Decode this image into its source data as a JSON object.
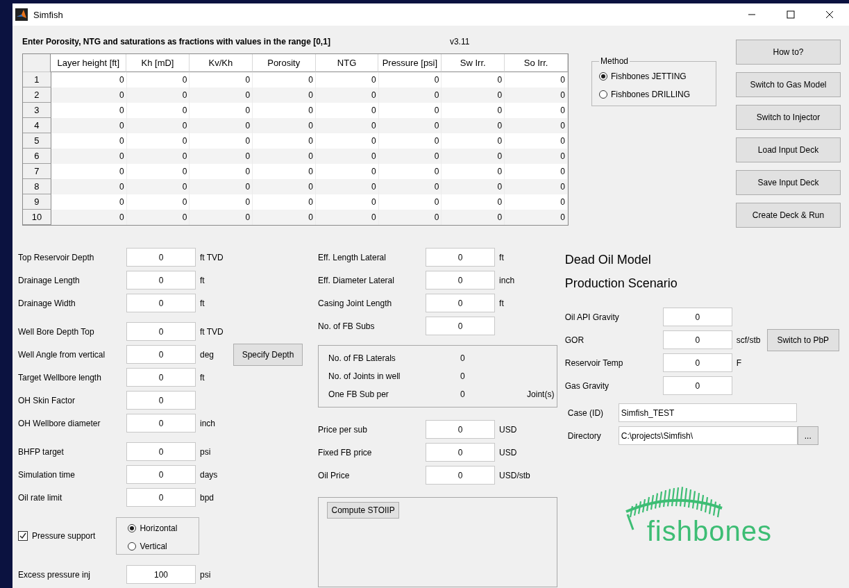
{
  "window": {
    "title": "Simfish"
  },
  "instructions": "Enter Porosity, NTG and saturations as fractions with values in the range [0,1]",
  "version": "v3.11",
  "table": {
    "columns": [
      "Layer height [ft]",
      "Kh [mD]",
      "Kv/Kh",
      "Porosity",
      "NTG",
      "Pressure [psi]",
      "Sw Irr.",
      "So Irr."
    ],
    "rows": [
      {
        "index": "1",
        "cells": [
          "0",
          "0",
          "0",
          "0",
          "0",
          "0",
          "0",
          "0"
        ]
      },
      {
        "index": "2",
        "cells": [
          "0",
          "0",
          "0",
          "0",
          "0",
          "0",
          "0",
          "0"
        ]
      },
      {
        "index": "3",
        "cells": [
          "0",
          "0",
          "0",
          "0",
          "0",
          "0",
          "0",
          "0"
        ]
      },
      {
        "index": "4",
        "cells": [
          "0",
          "0",
          "0",
          "0",
          "0",
          "0",
          "0",
          "0"
        ]
      },
      {
        "index": "5",
        "cells": [
          "0",
          "0",
          "0",
          "0",
          "0",
          "0",
          "0",
          "0"
        ]
      },
      {
        "index": "6",
        "cells": [
          "0",
          "0",
          "0",
          "0",
          "0",
          "0",
          "0",
          "0"
        ]
      },
      {
        "index": "7",
        "cells": [
          "0",
          "0",
          "0",
          "0",
          "0",
          "0",
          "0",
          "0"
        ]
      },
      {
        "index": "8",
        "cells": [
          "0",
          "0",
          "0",
          "0",
          "0",
          "0",
          "0",
          "0"
        ]
      },
      {
        "index": "9",
        "cells": [
          "0",
          "0",
          "0",
          "0",
          "0",
          "0",
          "0",
          "0"
        ]
      },
      {
        "index": "10",
        "cells": [
          "0",
          "0",
          "0",
          "0",
          "0",
          "0",
          "0",
          "0"
        ]
      }
    ]
  },
  "method": {
    "title": "Method",
    "options": [
      {
        "label": "Fishbones JETTING",
        "selected": true
      },
      {
        "label": "Fishbones DRILLING",
        "selected": false
      }
    ]
  },
  "buttons": [
    "How to?",
    "Switch to Gas Model",
    "Switch to Injector",
    "Load Input Deck",
    "Save Input Deck",
    "Create Deck & Run"
  ],
  "reservoir_groups": [
    [
      {
        "label": "Top Reservoir Depth",
        "value": "0",
        "unit": "ft TVD"
      },
      {
        "label": "Drainage Length",
        "value": "0",
        "unit": "ft"
      },
      {
        "label": "Drainage Width",
        "value": "0",
        "unit": "ft"
      }
    ],
    [
      {
        "label": "Well Bore Depth Top",
        "value": "0",
        "unit": "ft TVD"
      },
      {
        "label": "Well Angle from vertical",
        "value": "0",
        "unit": "deg",
        "button": "Specify Depth"
      },
      {
        "label": "Target Wellbore length",
        "value": "0",
        "unit": "ft"
      },
      {
        "label": "OH Skin Factor",
        "value": "0"
      },
      {
        "label": "OH Wellbore diameter",
        "value": "0",
        "unit": "inch"
      }
    ],
    [
      {
        "label": "BHFP target",
        "value": "0",
        "unit": "psi"
      },
      {
        "label": "Simulation time",
        "value": "0",
        "unit": "days"
      },
      {
        "label": "Oil rate limit",
        "value": "0",
        "unit": "bpd"
      }
    ]
  ],
  "pressure_support": {
    "label": "Pressure support",
    "checked": true
  },
  "orientation": {
    "options": [
      {
        "label": "Horizontal",
        "selected": true
      },
      {
        "label": "Vertical",
        "selected": false
      }
    ]
  },
  "excess_pressure": {
    "label": "Excess pressure inj",
    "value": "100",
    "unit": "psi"
  },
  "lateral_fields": [
    {
      "label": "Eff. Length Lateral",
      "value": "0",
      "unit": "ft"
    },
    {
      "label": "Eff. Diameter Lateral",
      "value": "0",
      "unit": "inch"
    },
    {
      "label": "Casing Joint Length",
      "value": "0",
      "unit": "ft"
    },
    {
      "label": "No. of FB Subs",
      "value": "0"
    }
  ],
  "fb_summary": [
    {
      "label": "No. of FB Laterals",
      "value": "0"
    },
    {
      "label": "No. of Joints in well",
      "value": "0"
    },
    {
      "label": "One FB Sub per",
      "value": "0",
      "unit": "Joint(s)"
    }
  ],
  "price_fields": [
    {
      "label": "Price per sub",
      "value": "0",
      "unit": "USD"
    },
    {
      "label": "Fixed FB price",
      "value": "0",
      "unit": "USD"
    },
    {
      "label": "Oil Price",
      "value": "0",
      "unit": "USD/stb"
    }
  ],
  "compute_button": "Compute STOIIP",
  "model_title": "Dead Oil Model",
  "scenario_title": "Production Scenario",
  "fluid_fields": [
    {
      "label": "Oil API Gravity",
      "value": "0"
    },
    {
      "label": "GOR",
      "value": "0",
      "unit": "scf/stb",
      "button": "Switch to PbP"
    },
    {
      "label": "Reservoir Temp",
      "value": "0",
      "unit": "F"
    },
    {
      "label": "Gas Gravity",
      "value": "0"
    }
  ],
  "case": {
    "label": "Case (ID)",
    "value": "Simfish_TEST"
  },
  "directory": {
    "label": "Directory",
    "value": "C:\\projects\\Simfish\\",
    "button": "..."
  },
  "logo_text": "fishbones"
}
